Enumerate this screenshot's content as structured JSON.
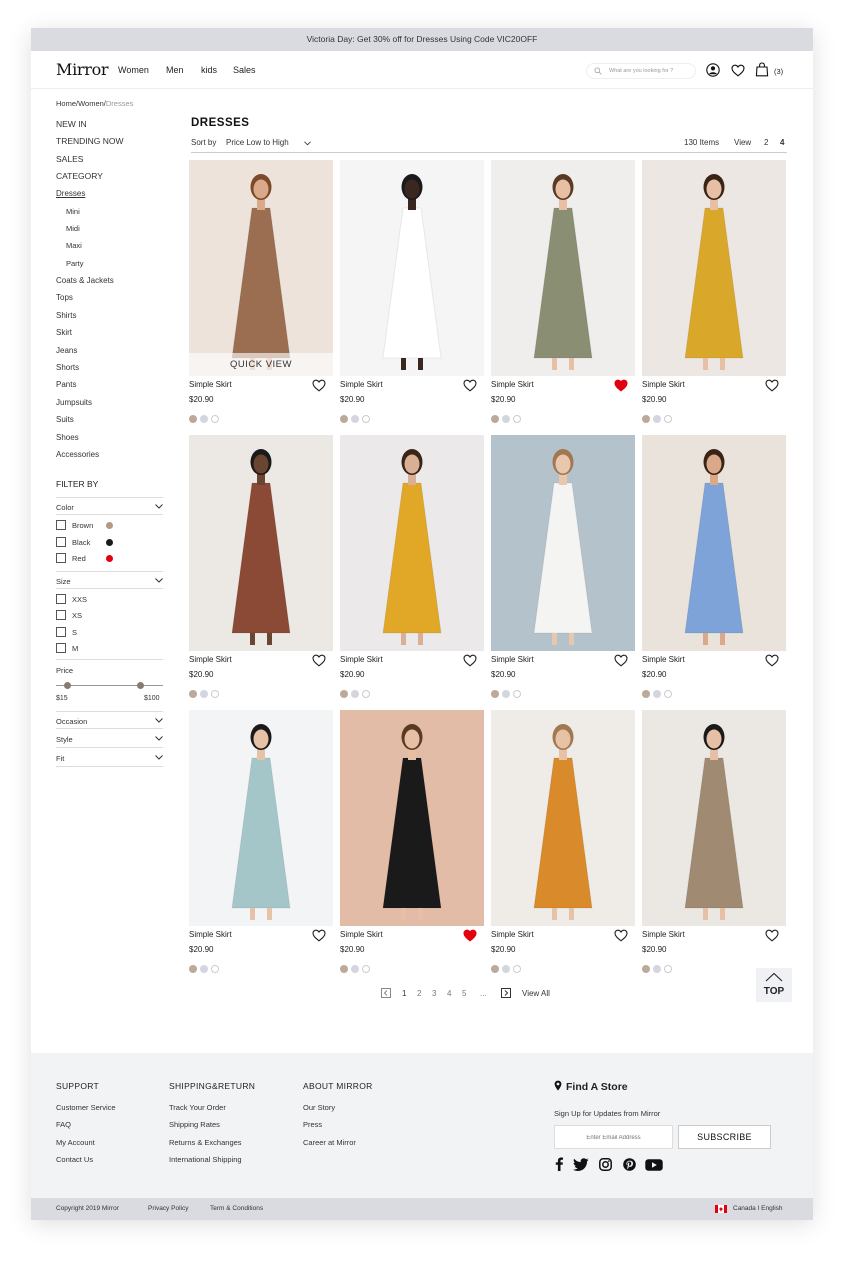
{
  "promo": "Victoria Day: Get 30% off for Dresses Using Code VIC20OFF",
  "header": {
    "logo": "Mirror",
    "nav": [
      "Women",
      "Men",
      "kids",
      "Sales"
    ],
    "search_placeholder": "What are you looking for ?",
    "cart_count": "(3)"
  },
  "breadcrumb": {
    "path": "Home/Women/",
    "current": "Dresses"
  },
  "sidebar": {
    "top": [
      "NEW IN",
      "TRENDING NOW",
      "SALES",
      "CATEGORY"
    ],
    "active_category": "Dresses",
    "subcategories": [
      "Mini",
      "Midi",
      "Maxi",
      "Party"
    ],
    "categories": [
      "Coats & Jackets",
      "Tops",
      "Shirts",
      "Skirt",
      "Jeans",
      "Shorts",
      "Pants",
      "Jumpsuits",
      "Suits",
      "Shoes",
      "Accessories"
    ]
  },
  "filters": {
    "heading": "FILTER BY",
    "color_label": "Color",
    "colors": [
      {
        "name": "Brown",
        "hex": "#b09a87"
      },
      {
        "name": "Black",
        "hex": "#1a1a1a"
      },
      {
        "name": "Red",
        "hex": "#e3000f"
      }
    ],
    "size_label": "Size",
    "sizes": [
      "XXS",
      "XS",
      "S",
      "M"
    ],
    "price_label": "Price",
    "price_min": "$15",
    "price_max": "$100",
    "other": [
      "Occasion",
      "Style",
      "Fit"
    ]
  },
  "listing": {
    "title": "DRESSES",
    "sort_label": "Sort by",
    "sort_value": "Price Low to High",
    "item_count": "130 Items",
    "view_label": "View",
    "view_options": [
      "2",
      "4"
    ],
    "selected_view": "4",
    "quick_view": "QUICK VIEW"
  },
  "products": [
    {
      "name": "Simple Skirt",
      "price": "$20.90",
      "favorited": false,
      "bg": "#ede3da",
      "dress": "#9b6e52",
      "skin": "#d9a98a",
      "hair": "#7a4a2a"
    },
    {
      "name": "Simple Skirt",
      "price": "$20.90",
      "favorited": false,
      "bg": "#f5f5f5",
      "dress": "#ffffff",
      "skin": "#3a2820",
      "hair": "#1a1a1a"
    },
    {
      "name": "Simple Skirt",
      "price": "$20.90",
      "favorited": true,
      "bg": "#f0eeec",
      "dress": "#8a8f74",
      "skin": "#e6bfa5",
      "hair": "#5a3a22"
    },
    {
      "name": "Simple Skirt",
      "price": "$20.90",
      "favorited": false,
      "bg": "#ece7e2",
      "dress": "#d9a82a",
      "skin": "#e6bfa5",
      "hair": "#3a2415"
    },
    {
      "name": "Simple Skirt",
      "price": "$20.90",
      "favorited": false,
      "bg": "#ece9e5",
      "dress": "#8a4a35",
      "skin": "#6a4632",
      "hair": "#1a1a1a"
    },
    {
      "name": "Simple Skirt",
      "price": "$20.90",
      "favorited": false,
      "bg": "#ebe9ea",
      "dress": "#e0a826",
      "skin": "#d9b096",
      "hair": "#3a2415"
    },
    {
      "name": "Simple Skirt",
      "price": "$20.90",
      "favorited": false,
      "bg": "#b4c2cc",
      "dress": "#f4f4f2",
      "skin": "#e8c7ad",
      "hair": "#a07852"
    },
    {
      "name": "Simple Skirt",
      "price": "$20.90",
      "favorited": false,
      "bg": "#e9e3dc",
      "dress": "#7ea3d8",
      "skin": "#d9a98a",
      "hair": "#3a2415"
    },
    {
      "name": "Simple Skirt",
      "price": "$20.90",
      "favorited": false,
      "bg": "#f3f4f5",
      "dress": "#a4c6c9",
      "skin": "#e6c2a6",
      "hair": "#1a1a1a"
    },
    {
      "name": "Simple Skirt",
      "price": "$20.90",
      "favorited": true,
      "bg": "#e3bca8",
      "dress": "#1a1a1a",
      "skin": "#e6bfa5",
      "hair": "#5a3a22"
    },
    {
      "name": "Simple Skirt",
      "price": "$20.90",
      "favorited": false,
      "bg": "#efebe7",
      "dress": "#d98a2a",
      "skin": "#e8c2a5",
      "hair": "#a07852"
    },
    {
      "name": "Simple Skirt",
      "price": "$20.90",
      "favorited": false,
      "bg": "#ebe7e3",
      "dress": "#a08a72",
      "skin": "#e6bfa5",
      "hair": "#1a1a1a"
    }
  ],
  "pagination": {
    "pages": [
      "1",
      "2",
      "3",
      "4",
      "5",
      "..."
    ],
    "view_all": "View All",
    "top": "TOP"
  },
  "footer": {
    "columns": [
      {
        "title": "SUPPORT",
        "links": [
          "Customer Service",
          "FAQ",
          "My Account",
          "Contact Us"
        ]
      },
      {
        "title": "SHIPPING&RETURN",
        "links": [
          "Track Your Order",
          "Shipping Rates",
          "Returns & Exchanges",
          "International Shipping"
        ]
      },
      {
        "title": "ABOUT MIRROR",
        "links": [
          "Our Story",
          "Press",
          "Career at Mirror"
        ]
      }
    ],
    "find_store": "Find A Store",
    "signup": "Sign Up for Updates from Mirror",
    "email_placeholder": "Enter Email Address",
    "subscribe": "SUBSCRIBE",
    "social_icons": [
      "facebook-icon",
      "twitter-icon",
      "instagram-icon",
      "pinterest-icon",
      "youtube-icon"
    ]
  },
  "bottom": {
    "copyright": "Copyright 2019 Mirror",
    "privacy": "Privacy Policy",
    "terms": "Term & Conditions",
    "locale": "Canada I English"
  }
}
